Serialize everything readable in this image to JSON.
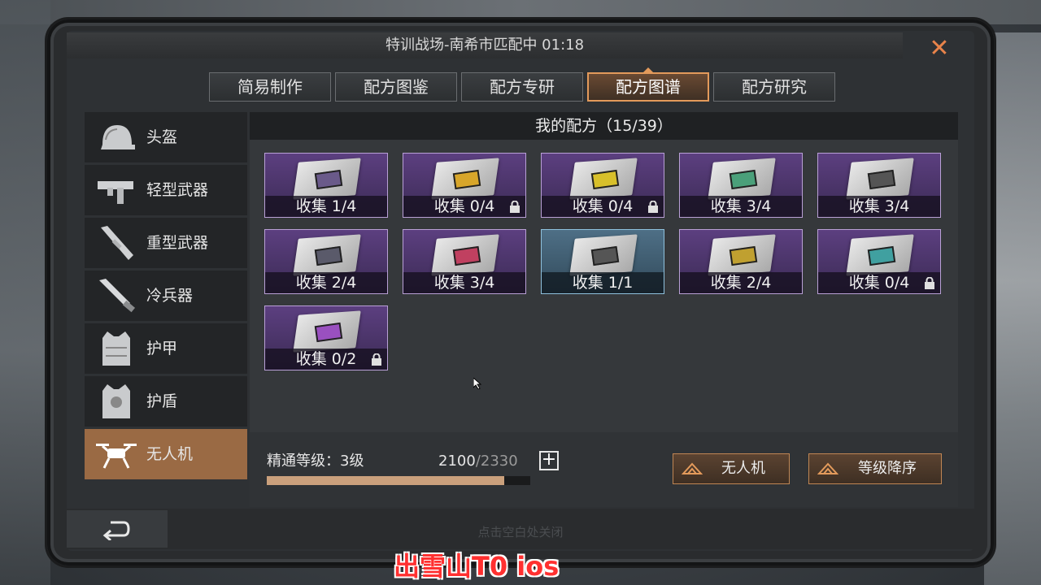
{
  "header": {
    "title": "特训战场-南希市匹配中 01:18",
    "close_icon": "close-icon"
  },
  "tabs": [
    {
      "label": "简易制作",
      "active": false
    },
    {
      "label": "配方图鉴",
      "active": false
    },
    {
      "label": "配方专研",
      "active": false
    },
    {
      "label": "配方图谱",
      "active": true
    },
    {
      "label": "配方研究",
      "active": false
    }
  ],
  "sidebar": {
    "items": [
      {
        "label": "头盔",
        "icon": "helmet-icon",
        "active": false
      },
      {
        "label": "轻型武器",
        "icon": "smg-icon",
        "active": false
      },
      {
        "label": "重型武器",
        "icon": "launcher-icon",
        "active": false
      },
      {
        "label": "冷兵器",
        "icon": "knife-icon",
        "active": false
      },
      {
        "label": "护甲",
        "icon": "vest-icon",
        "active": false
      },
      {
        "label": "护盾",
        "icon": "shield-vest-icon",
        "active": false
      },
      {
        "label": "无人机",
        "icon": "drone-icon",
        "active": true
      }
    ]
  },
  "panel": {
    "title": "我的配方（15/39）"
  },
  "recipes": [
    {
      "caption": "收集 1/4",
      "locked": false,
      "rarity": "purple",
      "chip": "#6a5a8a"
    },
    {
      "caption": "收集 0/4",
      "locked": true,
      "rarity": "purple",
      "chip": "#d8a62a"
    },
    {
      "caption": "收集 0/4",
      "locked": true,
      "rarity": "purple",
      "chip": "#d8c02a"
    },
    {
      "caption": "收集 3/4",
      "locked": false,
      "rarity": "purple",
      "chip": "#4aa07a"
    },
    {
      "caption": "收集 3/4",
      "locked": false,
      "rarity": "purple",
      "chip": "#555555"
    },
    {
      "caption": "收集 2/4",
      "locked": false,
      "rarity": "purple",
      "chip": "#5a5a6a"
    },
    {
      "caption": "收集 3/4",
      "locked": false,
      "rarity": "purple",
      "chip": "#c04060"
    },
    {
      "caption": "收集 1/1",
      "locked": false,
      "rarity": "blue",
      "chip": "#555555"
    },
    {
      "caption": "收集 2/4",
      "locked": false,
      "rarity": "purple",
      "chip": "#c0a030"
    },
    {
      "caption": "收集 0/4",
      "locked": true,
      "rarity": "purple",
      "chip": "#40a0a0"
    },
    {
      "caption": "收集 0/2",
      "locked": true,
      "rarity": "purple",
      "chip": "#9a50c0"
    }
  ],
  "mastery": {
    "label": "精通等级：3级",
    "current": "2100",
    "max": "/2330",
    "progress": 0.9,
    "plus": "+"
  },
  "filters": {
    "category": "无人机",
    "sort": "等级降序"
  },
  "footer": {
    "close_hint": "点击空白处关闭"
  },
  "watermark": "出雪山T0 ios",
  "colors": {
    "accent": "#e39a5b",
    "purple": "#5c3f80",
    "blue": "#4e6f86",
    "active_side": "#9a6a44"
  }
}
